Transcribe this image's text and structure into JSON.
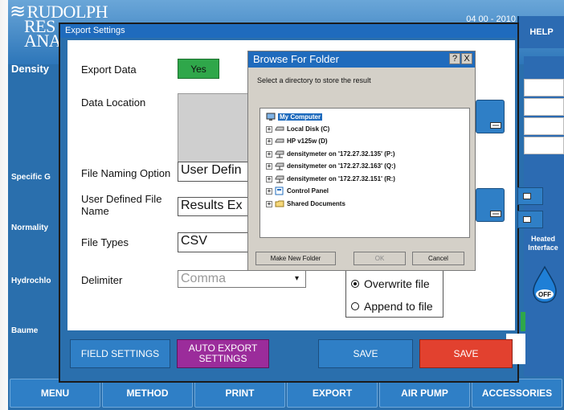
{
  "app": {
    "logo_lines": [
      "RUDOLPH",
      "RES",
      "ANA"
    ],
    "header_date": "04 00 - 2010",
    "help_label": "HELP",
    "side_labels": [
      "Density",
      "Specific G",
      "Normality",
      "Hydrochlo",
      "Baume"
    ],
    "heated_interface": "Heated Interface",
    "heater_state": "OFF",
    "nav": [
      "MENU",
      "METHOD",
      "PRINT",
      "EXPORT",
      "AIR PUMP",
      "ACCESSORIES"
    ]
  },
  "export_dialog": {
    "title": "Export Settings",
    "export_data_label": "Export Data",
    "export_data_value": "Yes",
    "data_location_label": "Data Location",
    "file_naming_label": "File Naming Option",
    "file_naming_value": "User Defin",
    "user_defined_label": "User Defined File Name",
    "user_defined_value": "Results Ex",
    "file_types_label": "File Types",
    "file_types_value": "CSV",
    "delimiter_label": "Delimiter",
    "delimiter_value": "Comma",
    "overwrite_label": "Overwrite file",
    "append_label": "Append to file",
    "field_settings_label": "FIELD SETTINGS",
    "auto_export_label": "AUTO EXPORT SETTINGS",
    "save_blue_label": "SAVE",
    "save_red_label": "SAVE"
  },
  "browse_dialog": {
    "title": "Browse For Folder",
    "help_glyph": "?",
    "close_glyph": "X",
    "instruction": "Select a directory to store the result",
    "tree": [
      {
        "label": "My Computer",
        "icon": "computer-icon",
        "selected": true
      },
      {
        "label": "Local Disk (C)",
        "icon": "drive-icon"
      },
      {
        "label": "HP v125w (D)",
        "icon": "drive-icon"
      },
      {
        "label": "densitymeter on '172.27.32.135' (P:)",
        "icon": "network-drive-icon"
      },
      {
        "label": "densitymeter on '172.27.32.163' (Q:)",
        "icon": "network-drive-icon"
      },
      {
        "label": "densitymeter on '172.27.32.151' (R:)",
        "icon": "network-drive-icon"
      },
      {
        "label": "Control Panel",
        "icon": "control-panel-icon"
      },
      {
        "label": "Shared Documents",
        "icon": "folder-icon"
      }
    ],
    "make_new_folder_label": "Make New Folder",
    "ok_label": "OK",
    "cancel_label": "Cancel"
  },
  "colors": {
    "app_blue": "#2a6fad",
    "title_blue": "#1f6bbd",
    "yes_green": "#2fa74a",
    "auto_export_purple": "#9b2c9b",
    "save_red": "#e2412f"
  }
}
